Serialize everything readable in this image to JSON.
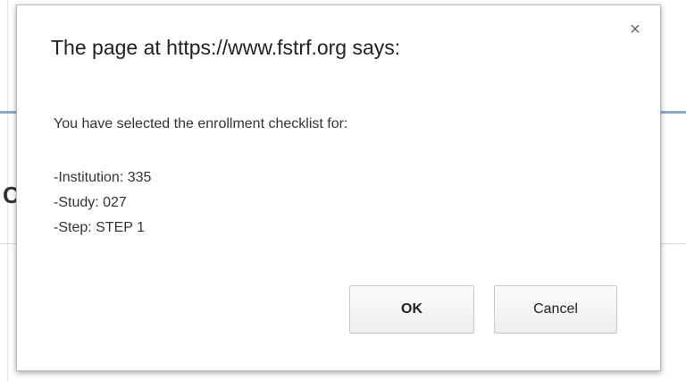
{
  "dialog": {
    "title": "The page at https://www.fstrf.org says:",
    "close_icon": "×",
    "message": {
      "intro": "You have selected the enrollment checklist for:",
      "institution": "-Institution: 335",
      "study": "-Study: 027",
      "step": "-Step: STEP 1"
    },
    "buttons": {
      "ok": "OK",
      "cancel": "Cancel"
    }
  },
  "background": {
    "partial_glyph": "C"
  }
}
